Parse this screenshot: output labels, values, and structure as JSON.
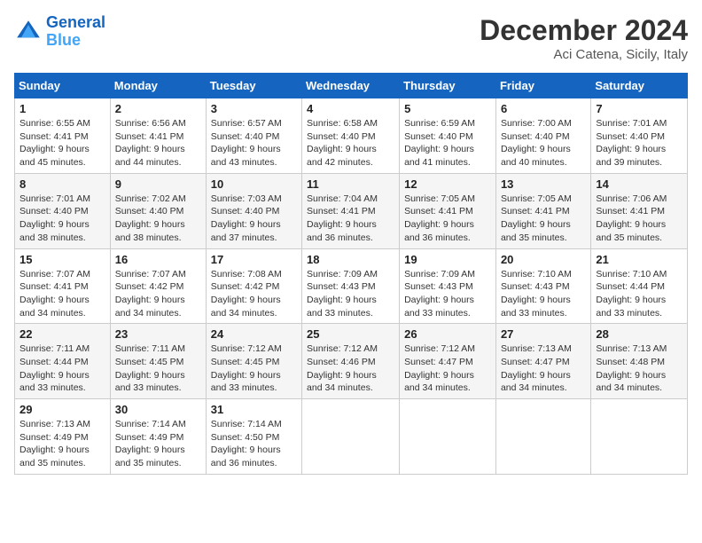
{
  "header": {
    "logo_line1": "General",
    "logo_line2": "Blue",
    "main_title": "December 2024",
    "subtitle": "Aci Catena, Sicily, Italy"
  },
  "calendar": {
    "days_of_week": [
      "Sunday",
      "Monday",
      "Tuesday",
      "Wednesday",
      "Thursday",
      "Friday",
      "Saturday"
    ],
    "weeks": [
      [
        {
          "day": "1",
          "sunrise": "6:55 AM",
          "sunset": "4:41 PM",
          "daylight": "9 hours and 45 minutes."
        },
        {
          "day": "2",
          "sunrise": "6:56 AM",
          "sunset": "4:41 PM",
          "daylight": "9 hours and 44 minutes."
        },
        {
          "day": "3",
          "sunrise": "6:57 AM",
          "sunset": "4:40 PM",
          "daylight": "9 hours and 43 minutes."
        },
        {
          "day": "4",
          "sunrise": "6:58 AM",
          "sunset": "4:40 PM",
          "daylight": "9 hours and 42 minutes."
        },
        {
          "day": "5",
          "sunrise": "6:59 AM",
          "sunset": "4:40 PM",
          "daylight": "9 hours and 41 minutes."
        },
        {
          "day": "6",
          "sunrise": "7:00 AM",
          "sunset": "4:40 PM",
          "daylight": "9 hours and 40 minutes."
        },
        {
          "day": "7",
          "sunrise": "7:01 AM",
          "sunset": "4:40 PM",
          "daylight": "9 hours and 39 minutes."
        }
      ],
      [
        {
          "day": "8",
          "sunrise": "7:01 AM",
          "sunset": "4:40 PM",
          "daylight": "9 hours and 38 minutes."
        },
        {
          "day": "9",
          "sunrise": "7:02 AM",
          "sunset": "4:40 PM",
          "daylight": "9 hours and 38 minutes."
        },
        {
          "day": "10",
          "sunrise": "7:03 AM",
          "sunset": "4:40 PM",
          "daylight": "9 hours and 37 minutes."
        },
        {
          "day": "11",
          "sunrise": "7:04 AM",
          "sunset": "4:41 PM",
          "daylight": "9 hours and 36 minutes."
        },
        {
          "day": "12",
          "sunrise": "7:05 AM",
          "sunset": "4:41 PM",
          "daylight": "9 hours and 36 minutes."
        },
        {
          "day": "13",
          "sunrise": "7:05 AM",
          "sunset": "4:41 PM",
          "daylight": "9 hours and 35 minutes."
        },
        {
          "day": "14",
          "sunrise": "7:06 AM",
          "sunset": "4:41 PM",
          "daylight": "9 hours and 35 minutes."
        }
      ],
      [
        {
          "day": "15",
          "sunrise": "7:07 AM",
          "sunset": "4:41 PM",
          "daylight": "9 hours and 34 minutes."
        },
        {
          "day": "16",
          "sunrise": "7:07 AM",
          "sunset": "4:42 PM",
          "daylight": "9 hours and 34 minutes."
        },
        {
          "day": "17",
          "sunrise": "7:08 AM",
          "sunset": "4:42 PM",
          "daylight": "9 hours and 34 minutes."
        },
        {
          "day": "18",
          "sunrise": "7:09 AM",
          "sunset": "4:43 PM",
          "daylight": "9 hours and 33 minutes."
        },
        {
          "day": "19",
          "sunrise": "7:09 AM",
          "sunset": "4:43 PM",
          "daylight": "9 hours and 33 minutes."
        },
        {
          "day": "20",
          "sunrise": "7:10 AM",
          "sunset": "4:43 PM",
          "daylight": "9 hours and 33 minutes."
        },
        {
          "day": "21",
          "sunrise": "7:10 AM",
          "sunset": "4:44 PM",
          "daylight": "9 hours and 33 minutes."
        }
      ],
      [
        {
          "day": "22",
          "sunrise": "7:11 AM",
          "sunset": "4:44 PM",
          "daylight": "9 hours and 33 minutes."
        },
        {
          "day": "23",
          "sunrise": "7:11 AM",
          "sunset": "4:45 PM",
          "daylight": "9 hours and 33 minutes."
        },
        {
          "day": "24",
          "sunrise": "7:12 AM",
          "sunset": "4:45 PM",
          "daylight": "9 hours and 33 minutes."
        },
        {
          "day": "25",
          "sunrise": "7:12 AM",
          "sunset": "4:46 PM",
          "daylight": "9 hours and 34 minutes."
        },
        {
          "day": "26",
          "sunrise": "7:12 AM",
          "sunset": "4:47 PM",
          "daylight": "9 hours and 34 minutes."
        },
        {
          "day": "27",
          "sunrise": "7:13 AM",
          "sunset": "4:47 PM",
          "daylight": "9 hours and 34 minutes."
        },
        {
          "day": "28",
          "sunrise": "7:13 AM",
          "sunset": "4:48 PM",
          "daylight": "9 hours and 34 minutes."
        }
      ],
      [
        {
          "day": "29",
          "sunrise": "7:13 AM",
          "sunset": "4:49 PM",
          "daylight": "9 hours and 35 minutes."
        },
        {
          "day": "30",
          "sunrise": "7:14 AM",
          "sunset": "4:49 PM",
          "daylight": "9 hours and 35 minutes."
        },
        {
          "day": "31",
          "sunrise": "7:14 AM",
          "sunset": "4:50 PM",
          "daylight": "9 hours and 36 minutes."
        },
        null,
        null,
        null,
        null
      ]
    ]
  }
}
